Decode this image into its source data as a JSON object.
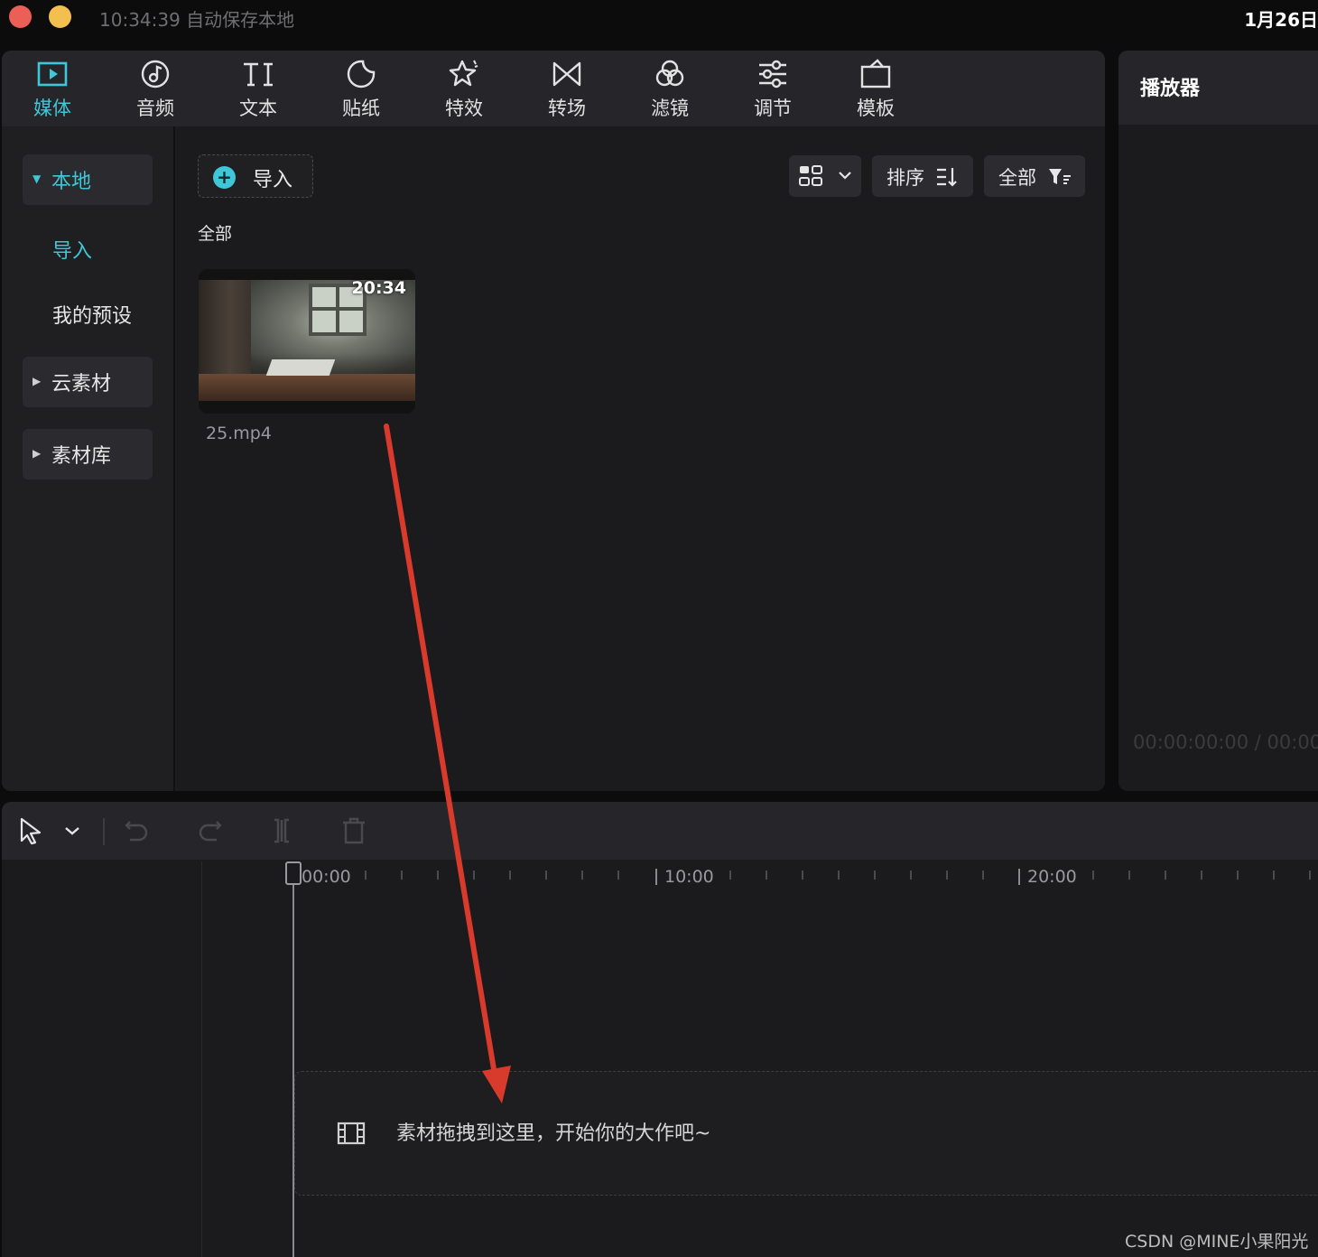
{
  "titlebar": {
    "save_status": "10:34:39 自动保存本地",
    "date": "1月26日"
  },
  "toolbar": {
    "tabs": [
      {
        "label": "媒体",
        "icon": "media-icon",
        "active": true
      },
      {
        "label": "音频",
        "icon": "audio-icon"
      },
      {
        "label": "文本",
        "icon": "text-icon"
      },
      {
        "label": "贴纸",
        "icon": "sticker-icon"
      },
      {
        "label": "特效",
        "icon": "effects-icon"
      },
      {
        "label": "转场",
        "icon": "transition-icon"
      },
      {
        "label": "滤镜",
        "icon": "filter-icon"
      },
      {
        "label": "调节",
        "icon": "adjust-icon"
      },
      {
        "label": "模板",
        "icon": "template-icon"
      }
    ]
  },
  "sidebar": {
    "local": "本地",
    "import": "导入",
    "presets": "我的预设",
    "cloud": "云素材",
    "library": "素材库"
  },
  "content": {
    "import_button": "导入",
    "sort_label": "排序",
    "filter_label": "全部",
    "section_title": "全部",
    "media_items": [
      {
        "name": "25.mp4",
        "duration": "20:34"
      }
    ]
  },
  "player": {
    "title": "播放器",
    "timecode": "00:00:00:00 / 00:00"
  },
  "timeline": {
    "ruler_labels": [
      "00:00",
      "10:00",
      "20:00"
    ],
    "drop_hint": "素材拖拽到这里，开始你的大作吧~"
  },
  "watermark": "CSDN @MINE小果阳光",
  "colors": {
    "accent": "#3fc6d8",
    "annotation_arrow": "#d83a2b"
  }
}
